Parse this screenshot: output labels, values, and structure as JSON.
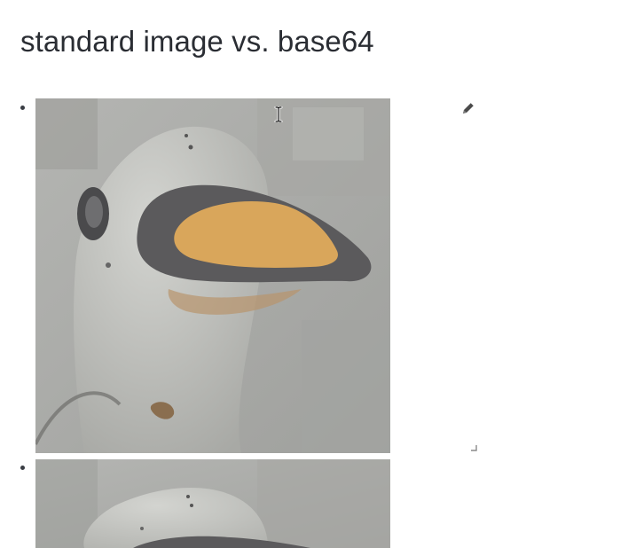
{
  "page": {
    "title": "standard image vs. base64"
  },
  "list": {
    "items": [
      {
        "type": "image",
        "icon": "bullet"
      },
      {
        "type": "image",
        "icon": "bullet"
      }
    ]
  },
  "icons": {
    "edit": "pencil-icon",
    "resize": "resize-handle-icon",
    "cursor": "text-cursor-icon"
  },
  "colors": {
    "title": "#2a2d33",
    "beak": "#d9a65b",
    "beak_rim": "#5b5a5c",
    "body": "#c9cac6",
    "background": "#a9aaa7"
  }
}
